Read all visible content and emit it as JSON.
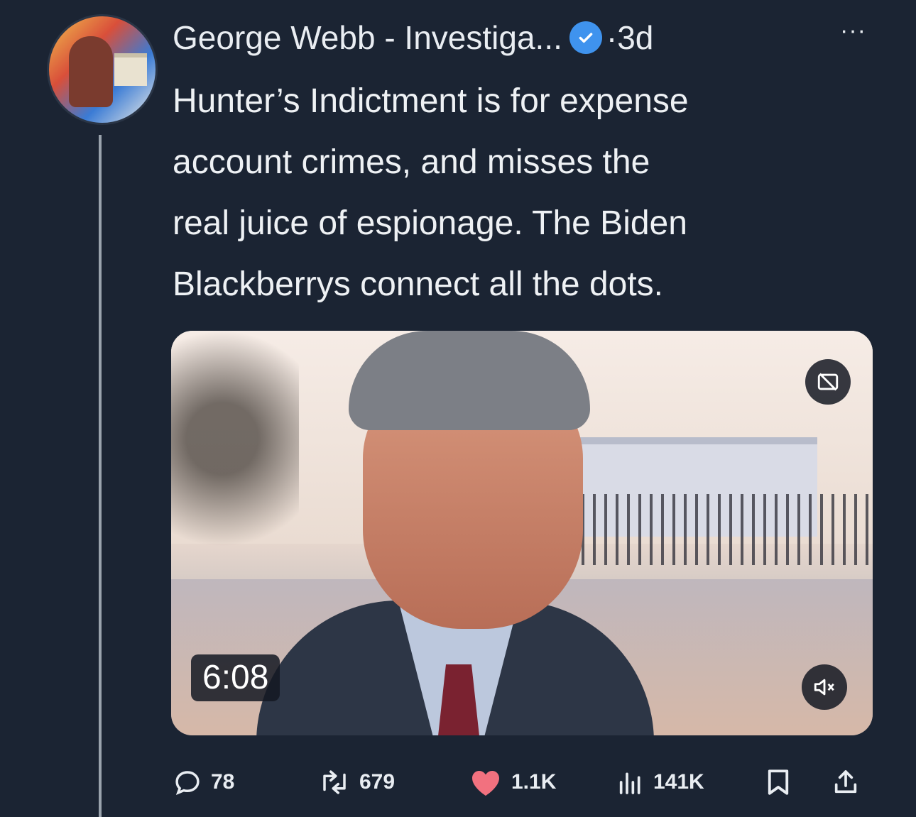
{
  "tweet": {
    "author_name": "George Webb - Investiga...",
    "separator_time": "·3d",
    "more_label": "···",
    "text_lines": [
      "Hunter’s Indictment is for expense",
      "account crimes, and misses the",
      "real juice of espionage. The Biden",
      "Blackberrys connect all the dots."
    ]
  },
  "media": {
    "duration": "6:08",
    "pip_icon": "picture-in-picture-off-icon",
    "mute_icon": "speaker-muted-icon"
  },
  "actions": {
    "replies": "78",
    "retweets": "679",
    "likes": "1.1K",
    "views": "141K"
  },
  "colors": {
    "background": "#1b2433",
    "verified_badge": "#3f93ee",
    "like_heart": "#f2717f"
  }
}
